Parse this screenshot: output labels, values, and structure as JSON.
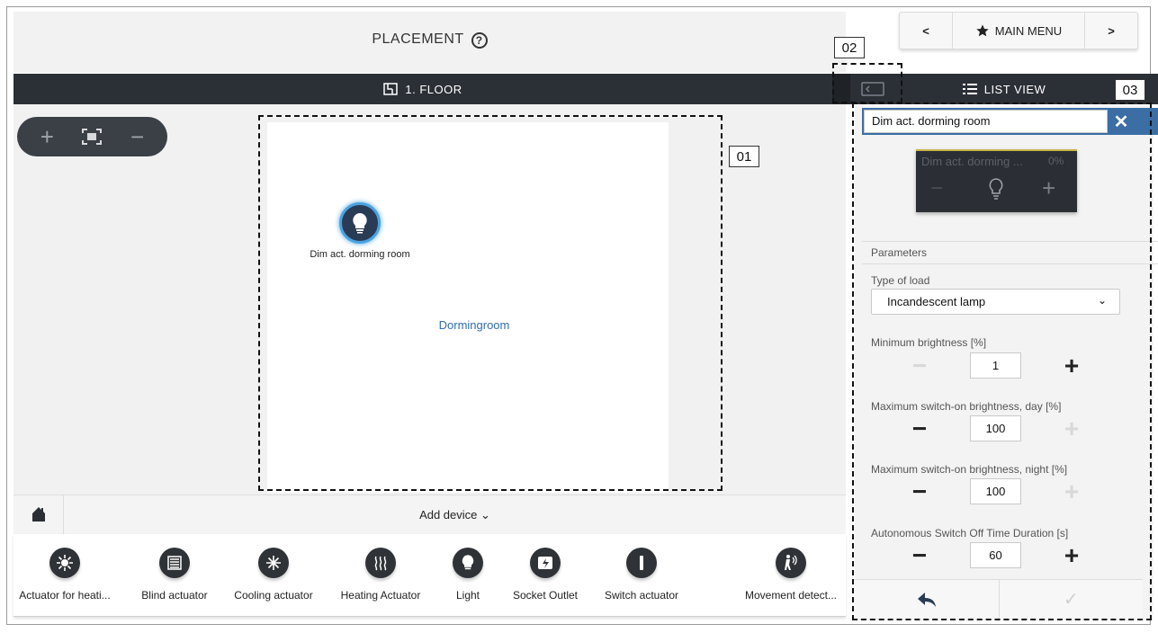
{
  "header": {
    "title": "PLACEMENT",
    "help_icon": "question-circle-icon"
  },
  "nav": {
    "prev": "‹",
    "main_menu": "MAIN MENU",
    "next": "›"
  },
  "floorbar": {
    "label": "1. FLOOR"
  },
  "listview": {
    "label": "LIST VIEW"
  },
  "callouts": {
    "c01": "01",
    "c02": "02",
    "c03": "03"
  },
  "plan": {
    "device_label": "Dim act. dorming room",
    "room_label": "Dormingroom"
  },
  "add_device": {
    "label": "Add device"
  },
  "tray": [
    {
      "label": "Actuator for heati...",
      "icon": "heating-actuator-icon"
    },
    {
      "label": "Blind actuator",
      "icon": "blind-icon"
    },
    {
      "label": "Cooling actuator",
      "icon": "snowflake-icon"
    },
    {
      "label": "Heating Actuator",
      "icon": "heat-waves-icon"
    },
    {
      "label": "Light",
      "icon": "bulb-icon"
    },
    {
      "label": "Socket Outlet",
      "icon": "socket-icon"
    },
    {
      "label": "Switch actuator",
      "icon": "switch-icon"
    },
    {
      "label": "Movement detect...",
      "icon": "movement-detector-icon"
    }
  ],
  "panel": {
    "device_name": "Dim act. dorming room",
    "tile": {
      "name": "Dim act. dorming ...",
      "percent": "0%"
    },
    "section": "Parameters",
    "type_of_load": {
      "label": "Type of load",
      "value": "Incandescent lamp"
    },
    "min_brightness": {
      "label": "Minimum brightness [%]",
      "value": "1"
    },
    "max_day": {
      "label": "Maximum switch-on brightness, day [%]",
      "value": "100"
    },
    "max_night": {
      "label": "Maximum switch-on brightness, night [%]",
      "value": "100"
    },
    "auto_off": {
      "label": "Autonomous Switch Off Time Duration [s]",
      "value": "60"
    }
  },
  "colors": {
    "accent_blue": "#3a6ea5",
    "dark_bar": "#2b2f36",
    "room_text": "#2f6fb3"
  }
}
